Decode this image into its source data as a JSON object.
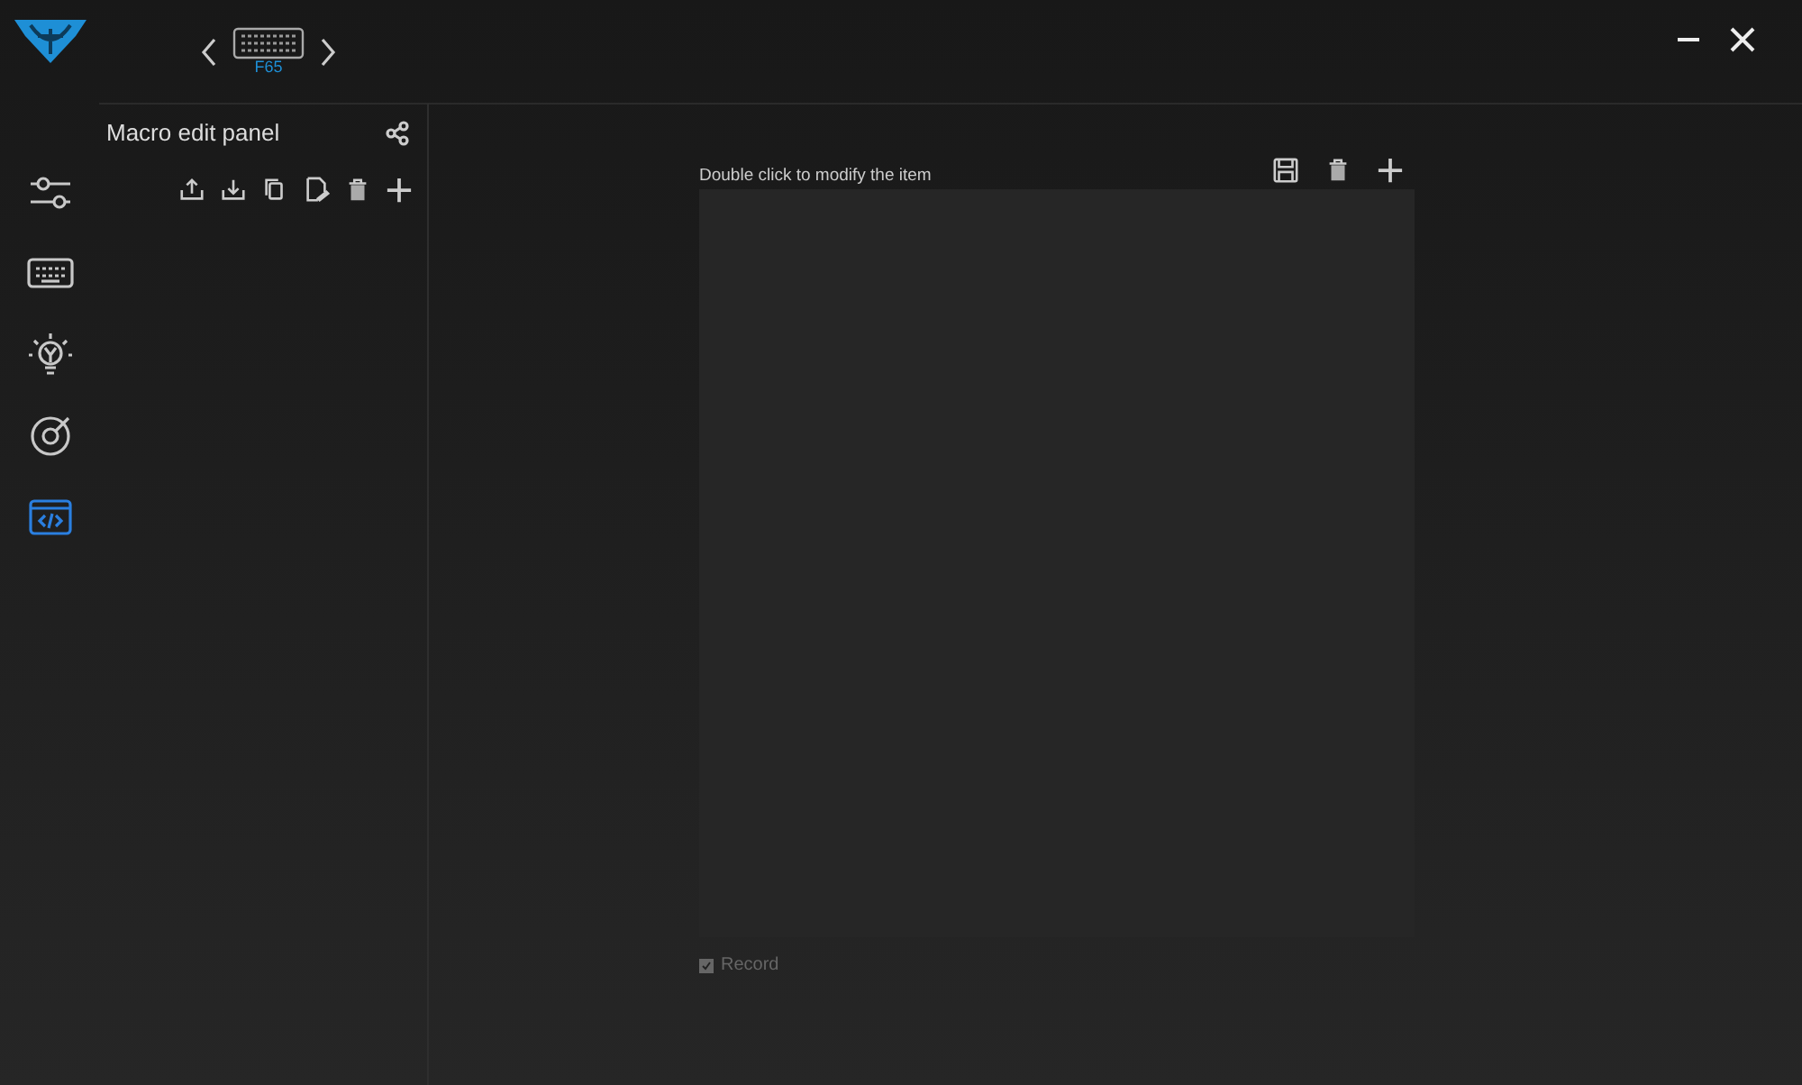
{
  "device": {
    "model": "F65"
  },
  "sidebar": {
    "items": [
      {
        "kind": "sliders",
        "selected": false
      },
      {
        "kind": "keyboard",
        "selected": false
      },
      {
        "kind": "light",
        "selected": false
      },
      {
        "kind": "target",
        "selected": false
      },
      {
        "kind": "macro",
        "selected": true
      }
    ]
  },
  "panel": {
    "title": "Macro edit panel",
    "toolbar": [
      {
        "kind": "export"
      },
      {
        "kind": "import"
      },
      {
        "kind": "copy"
      },
      {
        "kind": "rename"
      },
      {
        "kind": "delete"
      },
      {
        "kind": "add"
      }
    ]
  },
  "editor": {
    "hint": "Double click to modify the item",
    "toolbar": [
      {
        "kind": "save"
      },
      {
        "kind": "delete"
      },
      {
        "kind": "add"
      }
    ],
    "record": {
      "label": "Record",
      "checked": true,
      "disabled": true
    }
  }
}
